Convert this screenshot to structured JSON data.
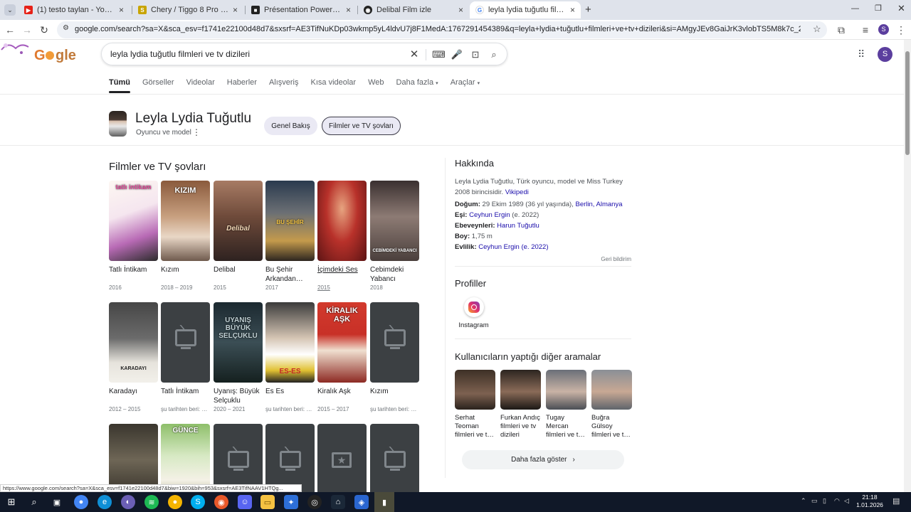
{
  "browser": {
    "tabs": [
      {
        "title": "(1) testo taylan - YouTube",
        "icon": "youtube-icon",
        "color": "#e62117"
      },
      {
        "title": "Chery / Tiggo 8 Pro Max / 1.6 T",
        "icon": "s-icon",
        "color": "#c8a400"
      },
      {
        "title": "Présentation PowerPoint",
        "icon": "shield-icon",
        "color": "#222"
      },
      {
        "title": "Delibal Film izle",
        "icon": "globe-icon",
        "color": "#222"
      },
      {
        "title": "leyla lydia tuğutlu filmleri ve tv",
        "icon": "google-icon",
        "color": "#4285f4"
      }
    ],
    "new_tab": "+",
    "url": "google.com/search?sa=X&sca_esv=f1741e22100d48d7&sxsrf=AE3TifNuKDp03wkmp5yL4ldvU7j8F1MedA:1767291454389&q=leyla+lydia+tuğutlu+filmleri+ve+tv+dizileri&si=AMgyJEv8GaiJrK3vlobTS5M8k7c_2HrRA-sG7VaoprInmi4DnJeI7xWYwjr7_2...",
    "profile_letter": "S"
  },
  "search": {
    "query": "leyla lydia tuğutlu filmleri ve tv dizileri"
  },
  "nav_tabs": [
    "Tümü",
    "Görseller",
    "Videolar",
    "Haberler",
    "Alışveriş",
    "Kısa videolar",
    "Web",
    "Daha fazla",
    "Araçlar"
  ],
  "entity": {
    "name": "Leyla Lydia Tuğutlu",
    "subtitle": "Oyuncu ve model",
    "pill_overview": "Genel Bakış",
    "pill_films": "Filmler ve TV şovları"
  },
  "films_section_title": "Filmler ve TV şovları",
  "films": [
    {
      "title": "Tatlı İntikam",
      "year": "2016",
      "poster": "tatli-intikam-poster",
      "overlay": "tatlı intikam"
    },
    {
      "title": "Kızım",
      "year": "2018 – 2019",
      "poster": "kizim-poster",
      "overlay": "KIZIM"
    },
    {
      "title": "Delibal",
      "year": "2015",
      "poster": "delibal-poster",
      "overlay": "Delibal"
    },
    {
      "title": "Bu Şehir Arkandan…",
      "year": "2017",
      "poster": "bu-sehir-poster",
      "overlay": "BU ŞEHİR"
    },
    {
      "title": "İçimdeki Ses",
      "year": "2015",
      "poster": "icimdeki-ses-poster",
      "overlay": ""
    },
    {
      "title": "Cebimdeki Yabancı",
      "year": "2018",
      "poster": "cebimdeki-poster",
      "overlay": "CEBİMDEKİ YABANCI"
    },
    {
      "title": "Karadayı",
      "year": "2012 – 2015",
      "poster": "karadayi-poster",
      "overlay": "KARADAYI"
    },
    {
      "title": "Tatlı İntikam",
      "year": "şu tarihten beri: …",
      "poster": "empty",
      "overlay": ""
    },
    {
      "title": "Uyanış: Büyük Selçuklu",
      "year": "2020 – 2021",
      "poster": "uyanis-poster",
      "overlay": "UYANIŞ BÜYÜK SELÇUKLU"
    },
    {
      "title": "Es Es",
      "year": "şu tarihten beri: …",
      "poster": "eses-poster",
      "overlay": "ES-ES"
    },
    {
      "title": "Kiralık Aşk",
      "year": "2015 – 2017",
      "poster": "kiralik-ask-poster",
      "overlay": "KİRALIK AŞK"
    },
    {
      "title": "Kızım",
      "year": "şu tarihten beri: …",
      "poster": "empty",
      "overlay": ""
    },
    {
      "title": "",
      "year": "",
      "poster": "row3-a-poster",
      "overlay": ""
    },
    {
      "title": "",
      "year": "",
      "poster": "gunce-poster",
      "overlay": "GÜNCE"
    },
    {
      "title": "",
      "year": "",
      "poster": "empty",
      "overlay": ""
    },
    {
      "title": "",
      "year": "",
      "poster": "empty",
      "overlay": ""
    },
    {
      "title": "",
      "year": "",
      "poster": "ticket",
      "overlay": ""
    },
    {
      "title": "",
      "year": "",
      "poster": "empty",
      "overlay": ""
    }
  ],
  "about": {
    "title": "Hakkında",
    "text": "Leyla Lydia Tuğutlu, Türk oyuncu, model ve Miss Turkey 2008 birincisidir.",
    "source": "Vikipedi",
    "facts": [
      {
        "label": "Doğum:",
        "value": "29 Ekim 1989 (36 yıl yaşında),",
        "link": "Berlin, Almanya"
      },
      {
        "label": "Eşi:",
        "value": "",
        "link": "Ceyhun Ergin",
        "suffix": "(e. 2022)"
      },
      {
        "label": "Ebeveynleri:",
        "value": "",
        "link": "Harun Tuğutlu"
      },
      {
        "label": "Boy:",
        "value": "1,75 m",
        "link": ""
      },
      {
        "label": "Evlilik:",
        "value": "",
        "link": "Ceyhun Ergin (e. 2022)"
      }
    ],
    "feedback": "Geri bildirim"
  },
  "profiles": {
    "title": "Profiller",
    "instagram": "Instagram"
  },
  "others": {
    "title": "Kullanıcıların yaptığı diğer aramalar",
    "people": [
      {
        "name": "Serhat Teoman filmleri ve t…",
        "color": "#3d3026"
      },
      {
        "name": "Furkan Andıç filmleri ve tv dizileri",
        "color": "#2c2520"
      },
      {
        "name": "Tugay Mercan filmleri ve t…",
        "color": "#6a6f78"
      },
      {
        "name": "Buğra Gülsoy filmleri ve t…",
        "color": "#8a8f96"
      }
    ],
    "more": "Daha fazla göster"
  },
  "status_url": "https://www.google.com/search?sa=X&sca_esv=f1741e22100d48d7&biw=1920&bih=953&sxsrf=AE3TifNAAV1HTQg...",
  "taskbar": {
    "time": "21:18",
    "date": "1.01.2026"
  }
}
